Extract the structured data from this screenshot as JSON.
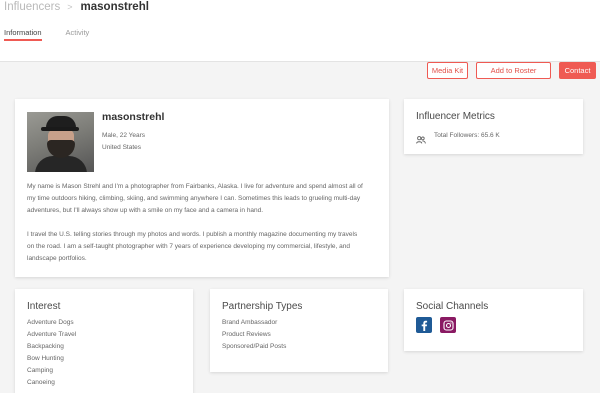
{
  "breadcrumb": {
    "parent": "Influencers",
    "separator": ">",
    "current": "masonstrehl"
  },
  "tabs": [
    {
      "label": "Information",
      "active": true
    },
    {
      "label": "Activity",
      "active": false
    }
  ],
  "actions": {
    "media_kit": "Media Kit",
    "add_to_roster": "Add to Roster",
    "contact": "Contact"
  },
  "profile": {
    "username": "masonstrehl",
    "gender_age": "Male, 22 Years",
    "location": "United States",
    "bio_paragraph_1_lines": [
      "My name is Mason Strehl and I'm a photographer from Fairbanks, Alaska. I live for adventure and spend almost all of",
      "my time outdoors hiking, climbing, skiing, and swimming anywhere I can. Sometimes this leads to grueling multi-day",
      "adventures, but I'll always show up with a smile on my face and a camera in hand."
    ],
    "bio_paragraph_2_lines": [
      "I travel the U.S. telling stories through my photos and words. I publish a monthly magazine documenting my travels",
      "on the road. I am a self-taught photographer with 7 years of experience developing my commercial, lifestyle, and",
      "landscape portfolios."
    ]
  },
  "metrics": {
    "title": "Influencer Metrics",
    "total_followers": "Total Followers: 65.6 K"
  },
  "interest": {
    "title": "Interest",
    "items": [
      "Adventure Dogs",
      "Adventure Travel",
      "Backpacking",
      "Bow Hunting",
      "Camping",
      "Canoeing"
    ]
  },
  "partnership": {
    "title": "Partnership Types",
    "items": [
      "Brand Ambassador",
      "Product Reviews",
      "Sponsored/Paid Posts"
    ]
  },
  "social": {
    "title": "Social Channels",
    "channels": [
      {
        "icon": "facebook-icon",
        "color": "#1f5a96"
      },
      {
        "icon": "instagram-icon",
        "color": "#8a1a63"
      }
    ]
  },
  "colors": {
    "accent": "#ef5a53",
    "page_bg": "#f4f4f4"
  }
}
